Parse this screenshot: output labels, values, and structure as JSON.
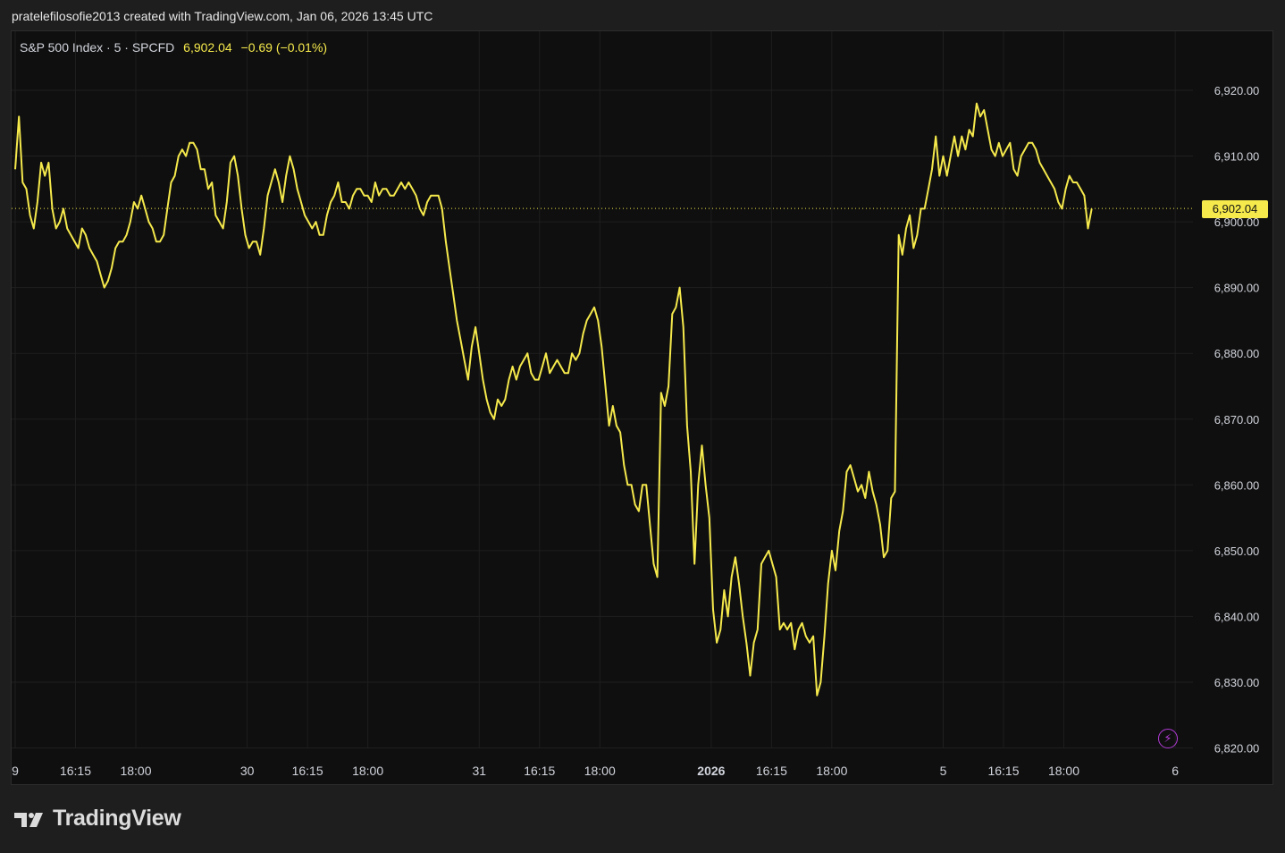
{
  "caption": "pratelefilosofie2013 created with TradingView.com, Jan 06, 2026 13:45 UTC",
  "legend": {
    "symbol": "S&P 500 Index · 5 · SPCFD",
    "last": "6,902.04",
    "change": "−0.69 (−0.01%)"
  },
  "last_price_label": "6,902.04",
  "brand": "TradingView",
  "colors": {
    "background": "#0f0f0f",
    "line": "#f5e94c",
    "grid": "#1f1f1f",
    "axis_text": "#d1d4dc"
  },
  "icons": {
    "flash": "lightning-bolt-icon",
    "logo": "tradingview-logo-icon"
  },
  "chart_data": {
    "type": "line",
    "title": "",
    "xlabel": "",
    "ylabel": "",
    "ylim": [
      6820,
      6925
    ],
    "yticks": [
      6920,
      6910,
      6900,
      6890,
      6880,
      6870,
      6860,
      6850,
      6840,
      6830,
      6820
    ],
    "ytick_labels": [
      "6,920.00",
      "6,910.00",
      "6,900.00",
      "6,890.00",
      "6,880.00",
      "6,870.00",
      "6,860.00",
      "6,850.00",
      "6,840.00",
      "6,830.00",
      "6,820.00"
    ],
    "xticks": [
      {
        "t": 0.0,
        "label": "9",
        "bold": false
      },
      {
        "t": 3.25,
        "label": "16:15",
        "bold": false
      },
      {
        "t": 6.5,
        "label": "18:00",
        "bold": false
      },
      {
        "t": 12.5,
        "label": "30",
        "bold": false
      },
      {
        "t": 15.75,
        "label": "16:15",
        "bold": false
      },
      {
        "t": 19.0,
        "label": "18:00",
        "bold": false
      },
      {
        "t": 25.0,
        "label": "31",
        "bold": false
      },
      {
        "t": 28.25,
        "label": "16:15",
        "bold": false
      },
      {
        "t": 31.5,
        "label": "18:00",
        "bold": false
      },
      {
        "t": 37.5,
        "label": "2026",
        "bold": true
      },
      {
        "t": 40.75,
        "label": "16:15",
        "bold": false
      },
      {
        "t": 44.0,
        "label": "18:00",
        "bold": false
      },
      {
        "t": 50.0,
        "label": "5",
        "bold": false
      },
      {
        "t": 53.25,
        "label": "16:15",
        "bold": false
      },
      {
        "t": 56.5,
        "label": "18:00",
        "bold": false
      },
      {
        "t": 62.5,
        "label": "6",
        "bold": false
      }
    ],
    "last_price": 6902.04,
    "series": [
      {
        "values": [
          [
            0.0,
            6908
          ],
          [
            0.2,
            6916
          ],
          [
            0.4,
            6906
          ],
          [
            0.6,
            6905
          ],
          [
            0.8,
            6901
          ],
          [
            1.0,
            6899
          ],
          [
            1.2,
            6903
          ],
          [
            1.4,
            6909
          ],
          [
            1.6,
            6907
          ],
          [
            1.8,
            6909
          ],
          [
            2.0,
            6902
          ],
          [
            2.2,
            6899
          ],
          [
            2.4,
            6900
          ],
          [
            2.6,
            6902
          ],
          [
            2.8,
            6899
          ],
          [
            3.0,
            6898
          ],
          [
            3.2,
            6897
          ],
          [
            3.4,
            6896
          ],
          [
            3.6,
            6899
          ],
          [
            3.8,
            6898
          ],
          [
            4.0,
            6896
          ],
          [
            4.2,
            6895
          ],
          [
            4.4,
            6894
          ],
          [
            4.6,
            6892
          ],
          [
            4.8,
            6890
          ],
          [
            5.0,
            6891
          ],
          [
            5.2,
            6893
          ],
          [
            5.4,
            6896
          ],
          [
            5.6,
            6897
          ],
          [
            5.8,
            6897
          ],
          [
            6.0,
            6898
          ],
          [
            6.2,
            6900
          ],
          [
            6.4,
            6903
          ],
          [
            6.6,
            6902
          ],
          [
            6.8,
            6904
          ],
          [
            7.0,
            6902
          ],
          [
            7.2,
            6900
          ],
          [
            7.4,
            6899
          ],
          [
            7.6,
            6897
          ],
          [
            7.8,
            6897
          ],
          [
            8.0,
            6898
          ],
          [
            8.2,
            6902
          ],
          [
            8.4,
            6906
          ],
          [
            8.6,
            6907
          ],
          [
            8.8,
            6910
          ],
          [
            9.0,
            6911
          ],
          [
            9.2,
            6910
          ],
          [
            9.4,
            6912
          ],
          [
            9.6,
            6912
          ],
          [
            9.8,
            6911
          ],
          [
            10.0,
            6908
          ],
          [
            10.2,
            6908
          ],
          [
            10.4,
            6905
          ],
          [
            10.6,
            6906
          ],
          [
            10.8,
            6901
          ],
          [
            11.0,
            6900
          ],
          [
            11.2,
            6899
          ],
          [
            11.4,
            6903
          ],
          [
            11.6,
            6909
          ],
          [
            11.8,
            6910
          ],
          [
            12.0,
            6907
          ],
          [
            12.2,
            6902
          ],
          [
            12.4,
            6898
          ],
          [
            12.6,
            6896
          ],
          [
            12.8,
            6897
          ],
          [
            13.0,
            6897
          ],
          [
            13.2,
            6895
          ],
          [
            13.4,
            6899
          ],
          [
            13.6,
            6904
          ],
          [
            13.8,
            6906
          ],
          [
            14.0,
            6908
          ],
          [
            14.2,
            6906
          ],
          [
            14.4,
            6903
          ],
          [
            14.6,
            6907
          ],
          [
            14.8,
            6910
          ],
          [
            15.0,
            6908
          ],
          [
            15.2,
            6905
          ],
          [
            15.4,
            6903
          ],
          [
            15.6,
            6901
          ],
          [
            15.8,
            6900
          ],
          [
            16.0,
            6899
          ],
          [
            16.2,
            6900
          ],
          [
            16.4,
            6898
          ],
          [
            16.6,
            6898
          ],
          [
            16.8,
            6901
          ],
          [
            17.0,
            6903
          ],
          [
            17.2,
            6904
          ],
          [
            17.4,
            6906
          ],
          [
            17.6,
            6903
          ],
          [
            17.8,
            6903
          ],
          [
            18.0,
            6902
          ],
          [
            18.2,
            6904
          ],
          [
            18.4,
            6905
          ],
          [
            18.6,
            6905
          ],
          [
            18.8,
            6904
          ],
          [
            19.0,
            6904
          ],
          [
            19.2,
            6903
          ],
          [
            19.4,
            6906
          ],
          [
            19.6,
            6904
          ],
          [
            19.8,
            6905
          ],
          [
            20.0,
            6905
          ],
          [
            20.2,
            6904
          ],
          [
            20.4,
            6904
          ],
          [
            20.6,
            6905
          ],
          [
            20.8,
            6906
          ],
          [
            21.0,
            6905
          ],
          [
            21.2,
            6906
          ],
          [
            21.4,
            6905
          ],
          [
            21.6,
            6904
          ],
          [
            21.8,
            6902
          ],
          [
            22.0,
            6901
          ],
          [
            22.2,
            6903
          ],
          [
            22.4,
            6904
          ],
          [
            22.6,
            6904
          ],
          [
            22.8,
            6904
          ],
          [
            23.0,
            6902
          ],
          [
            23.2,
            6897
          ],
          [
            23.4,
            6893
          ],
          [
            23.6,
            6889
          ],
          [
            23.8,
            6885
          ],
          [
            24.0,
            6882
          ],
          [
            24.2,
            6879
          ],
          [
            24.4,
            6876
          ],
          [
            24.6,
            6881
          ],
          [
            24.8,
            6884
          ],
          [
            25.0,
            6880
          ],
          [
            25.2,
            6876
          ],
          [
            25.4,
            6873
          ],
          [
            25.6,
            6871
          ],
          [
            25.8,
            6870
          ],
          [
            26.0,
            6873
          ],
          [
            26.2,
            6872
          ],
          [
            26.4,
            6873
          ],
          [
            26.6,
            6876
          ],
          [
            26.8,
            6878
          ],
          [
            27.0,
            6876
          ],
          [
            27.2,
            6878
          ],
          [
            27.4,
            6879
          ],
          [
            27.6,
            6880
          ],
          [
            27.8,
            6877
          ],
          [
            28.0,
            6876
          ],
          [
            28.2,
            6876
          ],
          [
            28.4,
            6878
          ],
          [
            28.6,
            6880
          ],
          [
            28.8,
            6877
          ],
          [
            29.0,
            6878
          ],
          [
            29.2,
            6879
          ],
          [
            29.4,
            6878
          ],
          [
            29.6,
            6877
          ],
          [
            29.8,
            6877
          ],
          [
            30.0,
            6880
          ],
          [
            30.2,
            6879
          ],
          [
            30.4,
            6880
          ],
          [
            30.6,
            6883
          ],
          [
            30.8,
            6885
          ],
          [
            31.0,
            6886
          ],
          [
            31.2,
            6887
          ],
          [
            31.4,
            6885
          ],
          [
            31.6,
            6881
          ],
          [
            31.8,
            6875
          ],
          [
            32.0,
            6869
          ],
          [
            32.2,
            6872
          ],
          [
            32.4,
            6869
          ],
          [
            32.6,
            6868
          ],
          [
            32.8,
            6863
          ],
          [
            33.0,
            6860
          ],
          [
            33.2,
            6860
          ],
          [
            33.4,
            6857
          ],
          [
            33.6,
            6856
          ],
          [
            33.8,
            6860
          ],
          [
            34.0,
            6860
          ],
          [
            34.2,
            6854
          ],
          [
            34.4,
            6848
          ],
          [
            34.6,
            6846
          ],
          [
            34.8,
            6874
          ],
          [
            35.0,
            6872
          ],
          [
            35.2,
            6875
          ],
          [
            35.4,
            6886
          ],
          [
            35.6,
            6887
          ],
          [
            35.8,
            6890
          ],
          [
            36.0,
            6884
          ],
          [
            36.2,
            6869
          ],
          [
            36.4,
            6862
          ],
          [
            36.6,
            6848
          ],
          [
            36.8,
            6860
          ],
          [
            37.0,
            6866
          ],
          [
            37.2,
            6860
          ],
          [
            37.4,
            6855
          ],
          [
            37.6,
            6841
          ],
          [
            37.8,
            6836
          ],
          [
            38.0,
            6838
          ],
          [
            38.2,
            6844
          ],
          [
            38.4,
            6840
          ],
          [
            38.6,
            6846
          ],
          [
            38.8,
            6849
          ],
          [
            39.0,
            6845
          ],
          [
            39.2,
            6840
          ],
          [
            39.4,
            6836
          ],
          [
            39.6,
            6831
          ],
          [
            39.8,
            6836
          ],
          [
            40.0,
            6838
          ],
          [
            40.2,
            6848
          ],
          [
            40.4,
            6849
          ],
          [
            40.6,
            6850
          ],
          [
            40.8,
            6848
          ],
          [
            41.0,
            6846
          ],
          [
            41.2,
            6838
          ],
          [
            41.4,
            6839
          ],
          [
            41.6,
            6838
          ],
          [
            41.8,
            6839
          ],
          [
            42.0,
            6835
          ],
          [
            42.2,
            6838
          ],
          [
            42.4,
            6839
          ],
          [
            42.6,
            6837
          ],
          [
            42.8,
            6836
          ],
          [
            43.0,
            6837
          ],
          [
            43.2,
            6828
          ],
          [
            43.4,
            6830
          ],
          [
            43.6,
            6837
          ],
          [
            43.8,
            6845
          ],
          [
            44.0,
            6850
          ],
          [
            44.2,
            6847
          ],
          [
            44.4,
            6853
          ],
          [
            44.6,
            6856
          ],
          [
            44.8,
            6862
          ],
          [
            45.0,
            6863
          ],
          [
            45.2,
            6861
          ],
          [
            45.4,
            6859
          ],
          [
            45.6,
            6860
          ],
          [
            45.8,
            6858
          ],
          [
            46.0,
            6862
          ],
          [
            46.2,
            6859
          ],
          [
            46.4,
            6857
          ],
          [
            46.6,
            6854
          ],
          [
            46.8,
            6849
          ],
          [
            47.0,
            6850
          ],
          [
            47.2,
            6858
          ],
          [
            47.4,
            6859
          ],
          [
            47.6,
            6898
          ],
          [
            47.8,
            6895
          ],
          [
            48.0,
            6899
          ],
          [
            48.2,
            6901
          ],
          [
            48.4,
            6896
          ],
          [
            48.6,
            6898
          ],
          [
            48.8,
            6902
          ],
          [
            49.0,
            6902
          ],
          [
            49.2,
            6905
          ],
          [
            49.4,
            6908
          ],
          [
            49.6,
            6913
          ],
          [
            49.8,
            6907
          ],
          [
            50.0,
            6910
          ],
          [
            50.2,
            6907
          ],
          [
            50.4,
            6910
          ],
          [
            50.6,
            6913
          ],
          [
            50.8,
            6910
          ],
          [
            51.0,
            6913
          ],
          [
            51.2,
            6911
          ],
          [
            51.4,
            6914
          ],
          [
            51.6,
            6913
          ],
          [
            51.8,
            6918
          ],
          [
            52.0,
            6916
          ],
          [
            52.2,
            6917
          ],
          [
            52.4,
            6914
          ],
          [
            52.6,
            6911
          ],
          [
            52.8,
            6910
          ],
          [
            53.0,
            6912
          ],
          [
            53.2,
            6910
          ],
          [
            53.4,
            6911
          ],
          [
            53.6,
            6912
          ],
          [
            53.8,
            6908
          ],
          [
            54.0,
            6907
          ],
          [
            54.2,
            6910
          ],
          [
            54.4,
            6911
          ],
          [
            54.6,
            6912
          ],
          [
            54.8,
            6912
          ],
          [
            55.0,
            6911
          ],
          [
            55.2,
            6909
          ],
          [
            55.4,
            6908
          ],
          [
            55.6,
            6907
          ],
          [
            55.8,
            6906
          ],
          [
            56.0,
            6905
          ],
          [
            56.2,
            6903
          ],
          [
            56.4,
            6902
          ],
          [
            56.6,
            6905
          ],
          [
            56.8,
            6907
          ],
          [
            57.0,
            6906
          ],
          [
            57.2,
            6906
          ],
          [
            57.4,
            6905
          ],
          [
            57.6,
            6904
          ],
          [
            57.8,
            6899
          ],
          [
            58.0,
            6902
          ]
        ]
      }
    ]
  }
}
